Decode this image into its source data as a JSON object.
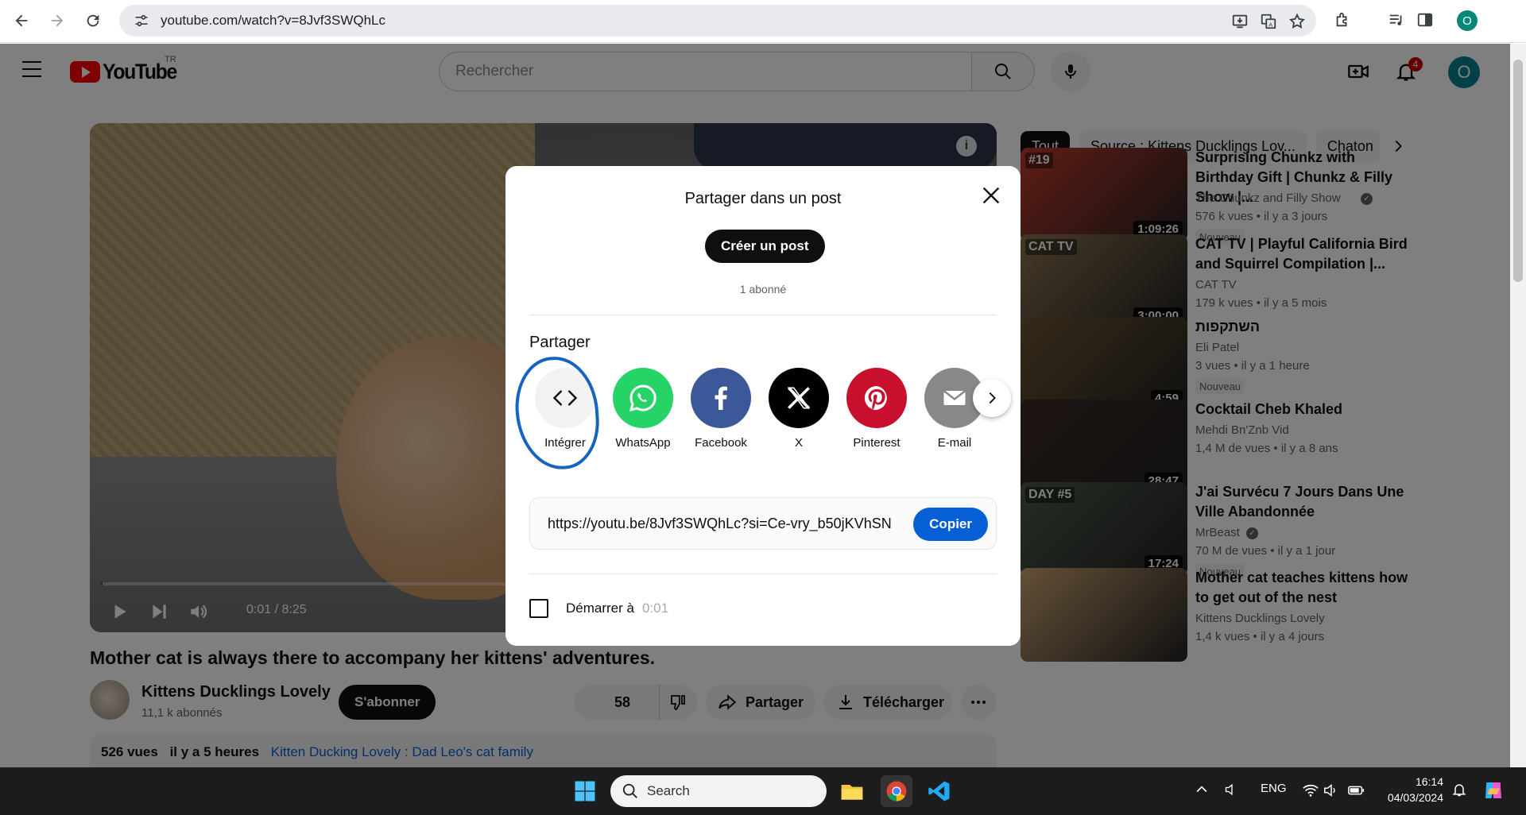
{
  "browser": {
    "url": "youtube.com/watch?v=8Jvf3SWQhLc",
    "profile_initial": "O"
  },
  "header": {
    "logo_text": "YouTube",
    "country_code": "TR",
    "search_placeholder": "Rechercher",
    "notifications_count": "4",
    "avatar_initial": "O"
  },
  "player": {
    "time": "0:01 / 8:25",
    "progress_fraction": 0.002,
    "info_glyph": "i"
  },
  "video": {
    "title": "Mother cat is always there to accompany her kittens' adventures.",
    "channel_name": "Kittens Ducklings Lovely",
    "channel_subs": "11,1 k abonnés",
    "subscribe_label": "S'abonner",
    "likes": "58",
    "share_label": "Partager",
    "download_label": "Télécharger",
    "views": "526 vues",
    "age": "il y a 5 heures",
    "description_tag": "Kitten Ducking Lovely : Dad Leo's cat family"
  },
  "chips": [
    "Tout",
    "Source : Kittens Ducklings Lov...",
    "Chaton"
  ],
  "recommendations": [
    {
      "title": "Surprising Chunkz with Birthday Gift | Chunkz & Filly Show |...",
      "channel": "The Chunkz and Filly Show",
      "verified": true,
      "views": "576 k vues",
      "age": "il y a 3 jours",
      "badge": "Nouveau",
      "duration": "1:09:26",
      "thumb_label": "#19",
      "color": "#c0392b"
    },
    {
      "title": "CAT TV | Playful California Bird and Squirrel Compilation |...",
      "channel": "CAT TV",
      "verified": false,
      "views": "179 k vues",
      "age": "il y a 5 mois",
      "badge": "",
      "duration": "3:00:00",
      "thumb_label": "CAT TV",
      "color": "#8a7350"
    },
    {
      "title": "השתקפות",
      "channel": "Eli Patel",
      "verified": false,
      "views": "3 vues",
      "age": "il y a 1 heure",
      "badge": "Nouveau",
      "duration": "4:59",
      "thumb_label": "",
      "color": "#6b5532"
    },
    {
      "title": "Cocktail Cheb Khaled",
      "channel": "Mehdi Bn'Znb Vid",
      "verified": false,
      "views": "1,4 M de vues",
      "age": "il y a 8 ans",
      "badge": "",
      "duration": "28:47",
      "thumb_label": "",
      "color": "#3b2a24"
    },
    {
      "title": "J'ai Survécu 7 Jours Dans Une Ville Abandonnée",
      "channel": "MrBeast",
      "verified": true,
      "views": "70 M de vues",
      "age": "il y a 1 jour",
      "badge": "Nouveau",
      "duration": "17:24",
      "thumb_label": "DAY #5",
      "color": "#4d5a4a"
    },
    {
      "title": "Mother cat teaches kittens how to get out of the nest",
      "channel": "Kittens Ducklings Lovely",
      "verified": false,
      "views": "1,4 k vues",
      "age": "il y a 4 jours",
      "badge": "",
      "duration": "",
      "thumb_label": "",
      "color": "#c8a070"
    }
  ],
  "share_modal": {
    "post_heading": "Partager dans un post",
    "create_post_label": "Créer un post",
    "subscriber_count": "1 abonné",
    "share_heading": "Partager",
    "targets": [
      {
        "label": "Intégrer",
        "icon": "embed-icon",
        "color": "#f2f2f2"
      },
      {
        "label": "WhatsApp",
        "icon": "whatsapp-icon",
        "color": "#25d366"
      },
      {
        "label": "Facebook",
        "icon": "facebook-icon",
        "color": "#3b5998"
      },
      {
        "label": "X",
        "icon": "x-icon",
        "color": "#000000"
      },
      {
        "label": "Pinterest",
        "icon": "pinterest-icon",
        "color": "#c8102e"
      },
      {
        "label": "E-mail",
        "icon": "email-icon",
        "color": "#888888"
      }
    ],
    "link": "https://youtu.be/8Jvf3SWQhLc?si=Ce-vry_b50jKVhSN",
    "copy_label": "Copier",
    "start_at_label": "Démarrer à",
    "start_at_time": "0:01"
  },
  "taskbar": {
    "search_label": "Search",
    "language": "ENG",
    "time": "16:14",
    "date": "04/03/2024"
  }
}
